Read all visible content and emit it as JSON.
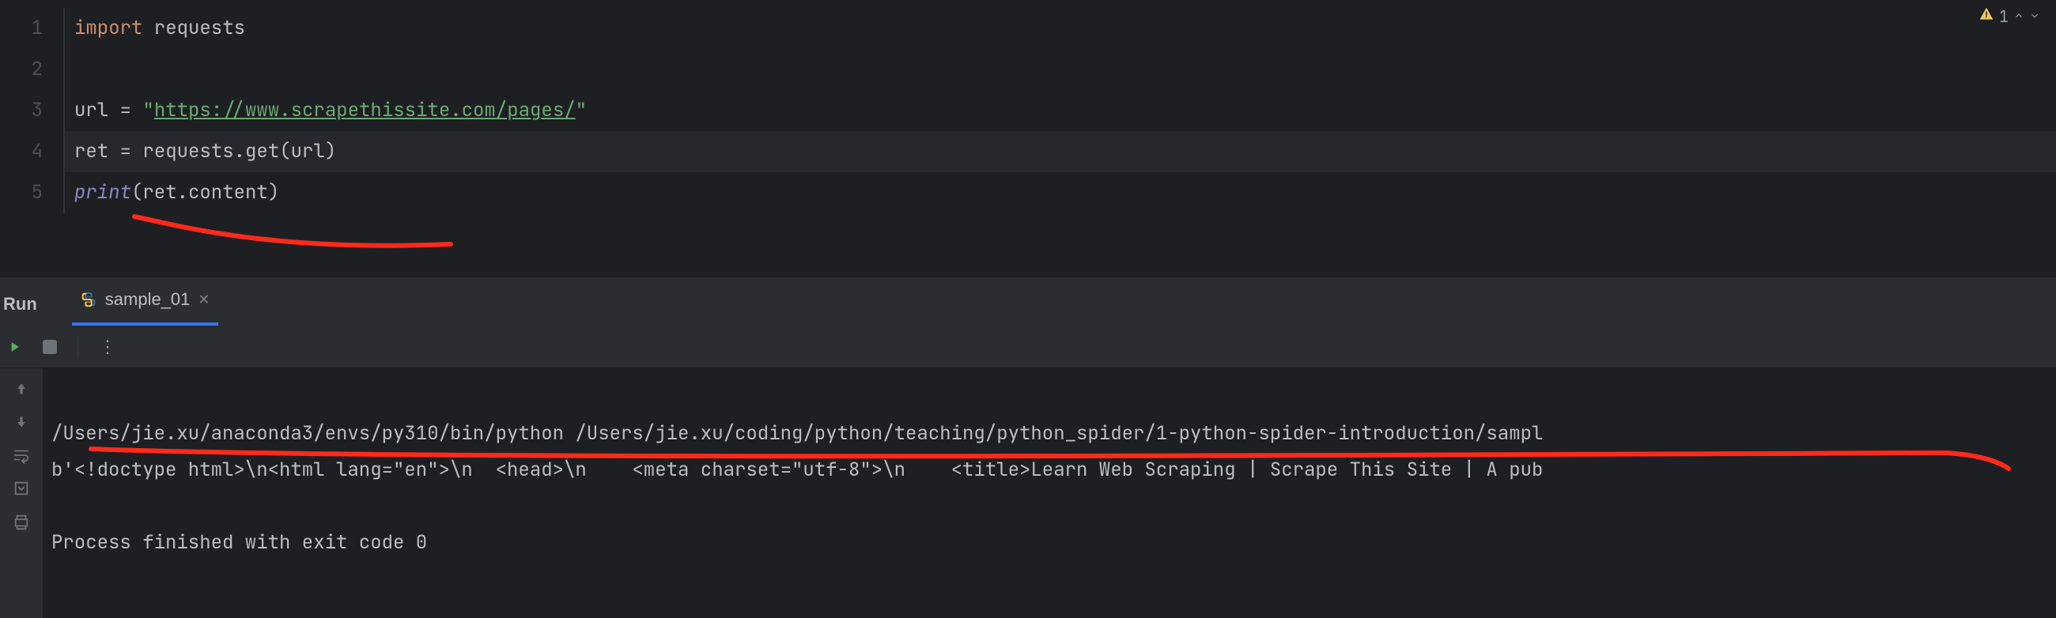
{
  "editor": {
    "lines": [
      "1",
      "2",
      "3",
      "4",
      "5"
    ],
    "code": {
      "l1_import": "import",
      "l1_mod": " requests",
      "l2": "",
      "l3_var": "url ",
      "l3_eq": "= ",
      "l3_q1": "\"",
      "l3_url": "https://www.scrapethissite.com/pages/",
      "l3_q2": "\"",
      "l4_var": "ret ",
      "l4_eq": "= ",
      "l4_call": "requests.get",
      "l4_p1": "(",
      "l4_arg": "url",
      "l4_p2": ")",
      "l5_fn": "print",
      "l5_p1": "(",
      "l5_arg": "ret.content",
      "l5_p2": ")"
    },
    "warnings": {
      "count": "1"
    }
  },
  "run": {
    "label": "Run",
    "tab": {
      "name": "sample_01"
    },
    "console": {
      "line1": "/Users/jie.xu/anaconda3/envs/py310/bin/python /Users/jie.xu/coding/python/teaching/python_spider/1-python-spider-introduction/sampl",
      "line2": "b'<!doctype html>\\n<html lang=\"en\">\\n  <head>\\n    <meta charset=\"utf-8\">\\n    <title>Learn Web Scraping | Scrape This Site | A pub",
      "line3": "",
      "line4": "Process finished with exit code 0"
    }
  },
  "icons": {
    "warning": "warning-triangle-icon",
    "python": "python-file-icon"
  }
}
